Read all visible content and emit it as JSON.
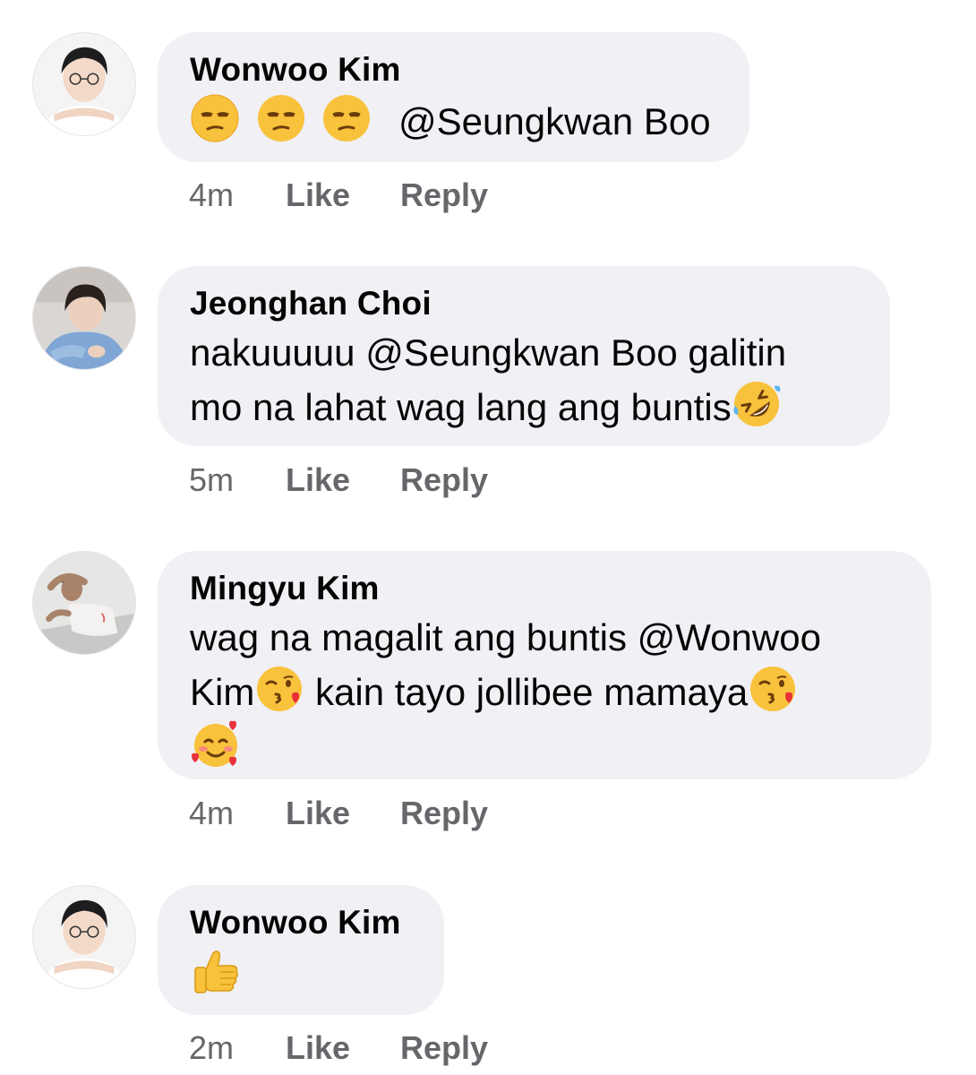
{
  "comments": [
    {
      "author": "Wonwoo Kim",
      "avatar_icon": "user-photo-avatar",
      "text_prefix": "",
      "mention1": "@Seungkwan Boo",
      "time": "4m",
      "like_label": "Like",
      "reply_label": "Reply"
    },
    {
      "author": "Jeonghan Choi",
      "avatar_icon": "user-photo-avatar",
      "line1_prefix": "nakuuuuu ",
      "mention1": "@Seungkwan Boo",
      "line1_suffix": " galitin",
      "line2": "mo na lahat wag lang ang buntis",
      "time": "5m",
      "like_label": "Like",
      "reply_label": "Reply"
    },
    {
      "author": "Mingyu Kim",
      "avatar_icon": "user-photo-avatar",
      "line1_prefix": "wag na magalit ang buntis ",
      "mention1": "@Wonwoo",
      "line2_mention": "Kim",
      "line2_suffix": " kain tayo jollibee mamaya",
      "time": "4m",
      "like_label": "Like",
      "reply_label": "Reply"
    },
    {
      "author": "Wonwoo Kim",
      "avatar_icon": "user-photo-avatar",
      "time": "2m",
      "like_label": "Like",
      "reply_label": "Reply"
    }
  ],
  "emoji_names": [
    "unamused-face-emoji",
    "rolling-on-floor-laughing-emoji",
    "face-blowing-kiss-emoji",
    "smiling-face-with-hearts-emoji",
    "thumbs-up-emoji"
  ],
  "colors": {
    "bubble": "#f0f0f5",
    "meta_text": "#65676b",
    "text": "#050505"
  }
}
